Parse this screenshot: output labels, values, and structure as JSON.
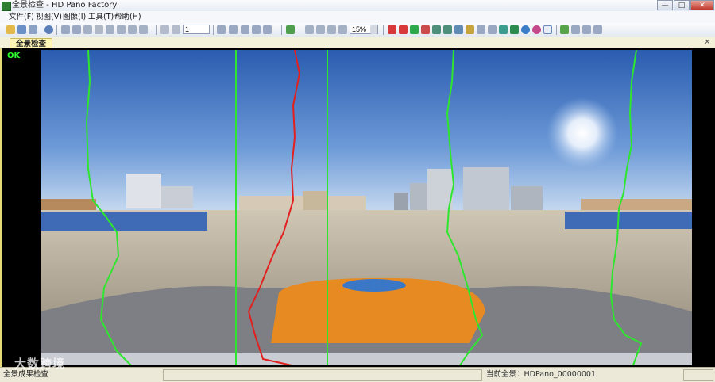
{
  "window": {
    "title": "全景检查 - HD Pano Factory",
    "minimize": "—",
    "maximize": "□",
    "close": "✕"
  },
  "menu": [
    {
      "label": "文件(F)"
    },
    {
      "label": "视图(V)"
    },
    {
      "label": "图像(I)"
    },
    {
      "label": "工具(T)"
    },
    {
      "label": "帮助(H)"
    }
  ],
  "toolbar": {
    "page_value": "1",
    "zoom_value": "15%"
  },
  "tabs": [
    {
      "label": "全景检查",
      "close": "✕"
    }
  ],
  "view": {
    "status_ok": "OK"
  },
  "status": {
    "left": "全景成果检查",
    "current_pano": "当前全景：HDPano_00000001"
  },
  "watermark": "大数跨境",
  "colors": {
    "seam_green": "#2ee62e",
    "seam_red": "#e32020",
    "car_orange": "#e88a22",
    "sky_top": "#2f63b8"
  }
}
